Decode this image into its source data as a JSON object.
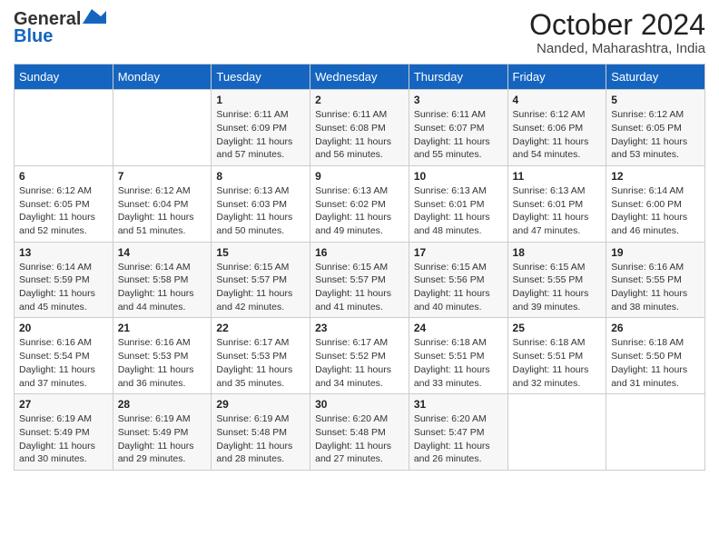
{
  "header": {
    "logo_line1": "General",
    "logo_line2": "Blue",
    "month": "October 2024",
    "location": "Nanded, Maharashtra, India"
  },
  "days_of_week": [
    "Sunday",
    "Monday",
    "Tuesday",
    "Wednesday",
    "Thursday",
    "Friday",
    "Saturday"
  ],
  "weeks": [
    [
      {
        "day": "",
        "info": ""
      },
      {
        "day": "",
        "info": ""
      },
      {
        "day": "1",
        "info": "Sunrise: 6:11 AM\nSunset: 6:09 PM\nDaylight: 11 hours and 57 minutes."
      },
      {
        "day": "2",
        "info": "Sunrise: 6:11 AM\nSunset: 6:08 PM\nDaylight: 11 hours and 56 minutes."
      },
      {
        "day": "3",
        "info": "Sunrise: 6:11 AM\nSunset: 6:07 PM\nDaylight: 11 hours and 55 minutes."
      },
      {
        "day": "4",
        "info": "Sunrise: 6:12 AM\nSunset: 6:06 PM\nDaylight: 11 hours and 54 minutes."
      },
      {
        "day": "5",
        "info": "Sunrise: 6:12 AM\nSunset: 6:05 PM\nDaylight: 11 hours and 53 minutes."
      }
    ],
    [
      {
        "day": "6",
        "info": "Sunrise: 6:12 AM\nSunset: 6:05 PM\nDaylight: 11 hours and 52 minutes."
      },
      {
        "day": "7",
        "info": "Sunrise: 6:12 AM\nSunset: 6:04 PM\nDaylight: 11 hours and 51 minutes."
      },
      {
        "day": "8",
        "info": "Sunrise: 6:13 AM\nSunset: 6:03 PM\nDaylight: 11 hours and 50 minutes."
      },
      {
        "day": "9",
        "info": "Sunrise: 6:13 AM\nSunset: 6:02 PM\nDaylight: 11 hours and 49 minutes."
      },
      {
        "day": "10",
        "info": "Sunrise: 6:13 AM\nSunset: 6:01 PM\nDaylight: 11 hours and 48 minutes."
      },
      {
        "day": "11",
        "info": "Sunrise: 6:13 AM\nSunset: 6:01 PM\nDaylight: 11 hours and 47 minutes."
      },
      {
        "day": "12",
        "info": "Sunrise: 6:14 AM\nSunset: 6:00 PM\nDaylight: 11 hours and 46 minutes."
      }
    ],
    [
      {
        "day": "13",
        "info": "Sunrise: 6:14 AM\nSunset: 5:59 PM\nDaylight: 11 hours and 45 minutes."
      },
      {
        "day": "14",
        "info": "Sunrise: 6:14 AM\nSunset: 5:58 PM\nDaylight: 11 hours and 44 minutes."
      },
      {
        "day": "15",
        "info": "Sunrise: 6:15 AM\nSunset: 5:57 PM\nDaylight: 11 hours and 42 minutes."
      },
      {
        "day": "16",
        "info": "Sunrise: 6:15 AM\nSunset: 5:57 PM\nDaylight: 11 hours and 41 minutes."
      },
      {
        "day": "17",
        "info": "Sunrise: 6:15 AM\nSunset: 5:56 PM\nDaylight: 11 hours and 40 minutes."
      },
      {
        "day": "18",
        "info": "Sunrise: 6:15 AM\nSunset: 5:55 PM\nDaylight: 11 hours and 39 minutes."
      },
      {
        "day": "19",
        "info": "Sunrise: 6:16 AM\nSunset: 5:55 PM\nDaylight: 11 hours and 38 minutes."
      }
    ],
    [
      {
        "day": "20",
        "info": "Sunrise: 6:16 AM\nSunset: 5:54 PM\nDaylight: 11 hours and 37 minutes."
      },
      {
        "day": "21",
        "info": "Sunrise: 6:16 AM\nSunset: 5:53 PM\nDaylight: 11 hours and 36 minutes."
      },
      {
        "day": "22",
        "info": "Sunrise: 6:17 AM\nSunset: 5:53 PM\nDaylight: 11 hours and 35 minutes."
      },
      {
        "day": "23",
        "info": "Sunrise: 6:17 AM\nSunset: 5:52 PM\nDaylight: 11 hours and 34 minutes."
      },
      {
        "day": "24",
        "info": "Sunrise: 6:18 AM\nSunset: 5:51 PM\nDaylight: 11 hours and 33 minutes."
      },
      {
        "day": "25",
        "info": "Sunrise: 6:18 AM\nSunset: 5:51 PM\nDaylight: 11 hours and 32 minutes."
      },
      {
        "day": "26",
        "info": "Sunrise: 6:18 AM\nSunset: 5:50 PM\nDaylight: 11 hours and 31 minutes."
      }
    ],
    [
      {
        "day": "27",
        "info": "Sunrise: 6:19 AM\nSunset: 5:49 PM\nDaylight: 11 hours and 30 minutes."
      },
      {
        "day": "28",
        "info": "Sunrise: 6:19 AM\nSunset: 5:49 PM\nDaylight: 11 hours and 29 minutes."
      },
      {
        "day": "29",
        "info": "Sunrise: 6:19 AM\nSunset: 5:48 PM\nDaylight: 11 hours and 28 minutes."
      },
      {
        "day": "30",
        "info": "Sunrise: 6:20 AM\nSunset: 5:48 PM\nDaylight: 11 hours and 27 minutes."
      },
      {
        "day": "31",
        "info": "Sunrise: 6:20 AM\nSunset: 5:47 PM\nDaylight: 11 hours and 26 minutes."
      },
      {
        "day": "",
        "info": ""
      },
      {
        "day": "",
        "info": ""
      }
    ]
  ]
}
